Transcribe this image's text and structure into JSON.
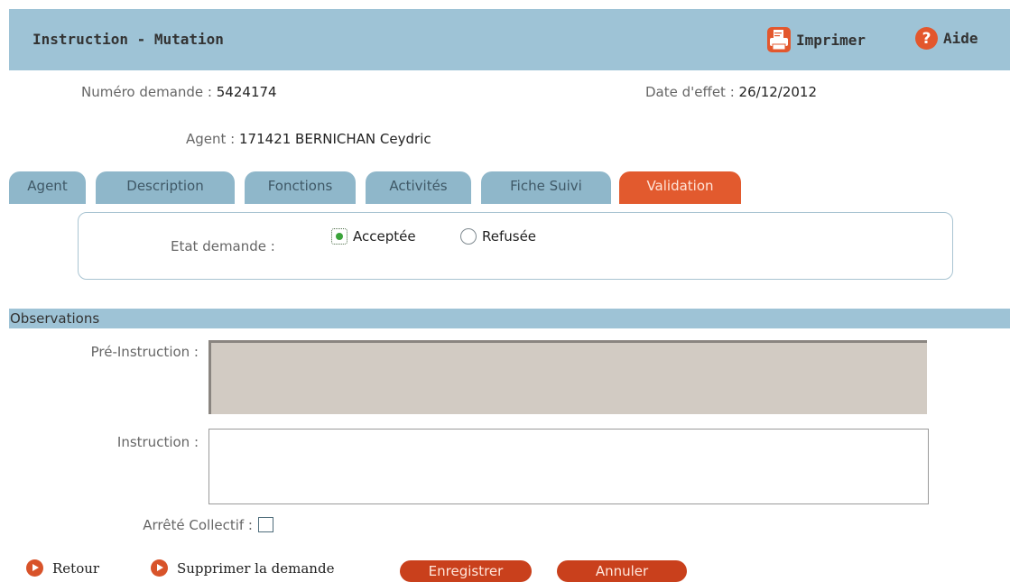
{
  "header": {
    "title": "Instruction - Mutation",
    "print_label": "Imprimer",
    "help_label": "Aide",
    "print_icon": "printer-icon",
    "help_icon": "help-question-icon"
  },
  "request": {
    "numero_label": "Numéro demande :",
    "numero_value": "5424174",
    "date_label": "Date d'effet :",
    "date_value": "26/12/2012",
    "agent_label": "Agent :",
    "agent_value": "171421 BERNICHAN Ceydric"
  },
  "tabs": [
    {
      "label": "Agent",
      "active": false
    },
    {
      "label": "Description",
      "active": false
    },
    {
      "label": "Fonctions",
      "active": false
    },
    {
      "label": "Activités",
      "active": false
    },
    {
      "label": "Fiche Suivi",
      "active": false
    },
    {
      "label": "Validation",
      "active": true
    }
  ],
  "validation": {
    "etat_label": "Etat demande :",
    "options": [
      {
        "label": "Acceptée",
        "checked": true
      },
      {
        "label": "Refusée",
        "checked": false
      }
    ]
  },
  "observations": {
    "section_title": "Observations",
    "pre_instruction_label": "Pré-Instruction :",
    "pre_instruction_value": "",
    "instruction_label": "Instruction :",
    "instruction_value": "",
    "arrete_label": "Arrêté Collectif :",
    "arrete_checked": false
  },
  "actions": {
    "retour_label": "Retour",
    "supprimer_label": "Supprimer la demande",
    "enregistrer_label": "Enregistrer",
    "annuler_label": "Annuler"
  },
  "colors": {
    "header_bg": "#9ec3d6",
    "tab_bg": "#8fb7ca",
    "tab_active_bg": "#e25a2e",
    "button_bg": "#c9401c"
  }
}
